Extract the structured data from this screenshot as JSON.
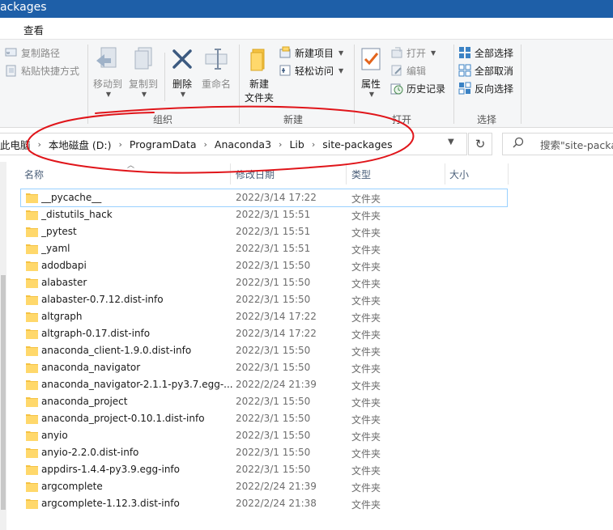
{
  "window": {
    "title": "ackages"
  },
  "ribbon_tab": "查看",
  "ribbon": {
    "clipboard_small": [
      {
        "label": "复制路径",
        "icon": "copy-path-icon"
      },
      {
        "label": "粘贴快捷方式",
        "icon": "paste-shortcut-icon"
      }
    ],
    "move_to": "移动到",
    "copy_to": "复制到",
    "delete": "删除",
    "rename": "重命名",
    "organize_label": "组织",
    "new_folder_line1": "新建",
    "new_folder_line2": "文件夹",
    "new_item": "新建项目",
    "easy_access": "轻松访问",
    "new_label": "新建",
    "properties": "属性",
    "open": "打开",
    "edit": "编辑",
    "history": "历史记录",
    "open_label": "打开",
    "select_all": "全部选择",
    "select_none": "全部取消",
    "invert_selection": "反向选择",
    "select_label": "选择"
  },
  "address": {
    "crumbs": [
      "此电脑",
      "本地磁盘 (D:)",
      "ProgramData",
      "Anaconda3",
      "Lib",
      "site-packages"
    ],
    "search_placeholder": "搜索\"site-packages\""
  },
  "columns": {
    "name": "名称",
    "date": "修改日期",
    "type": "类型",
    "size": "大小"
  },
  "files": [
    {
      "name": "__pycache__",
      "date": "2022/3/14 17:22",
      "type": "文件夹",
      "selected": true
    },
    {
      "name": "_distutils_hack",
      "date": "2022/3/1 15:51",
      "type": "文件夹"
    },
    {
      "name": "_pytest",
      "date": "2022/3/1 15:51",
      "type": "文件夹"
    },
    {
      "name": "_yaml",
      "date": "2022/3/1 15:51",
      "type": "文件夹"
    },
    {
      "name": "adodbapi",
      "date": "2022/3/1 15:50",
      "type": "文件夹"
    },
    {
      "name": "alabaster",
      "date": "2022/3/1 15:50",
      "type": "文件夹"
    },
    {
      "name": "alabaster-0.7.12.dist-info",
      "date": "2022/3/1 15:50",
      "type": "文件夹"
    },
    {
      "name": "altgraph",
      "date": "2022/3/14 17:22",
      "type": "文件夹"
    },
    {
      "name": "altgraph-0.17.dist-info",
      "date": "2022/3/14 17:22",
      "type": "文件夹"
    },
    {
      "name": "anaconda_client-1.9.0.dist-info",
      "date": "2022/3/1 15:50",
      "type": "文件夹"
    },
    {
      "name": "anaconda_navigator",
      "date": "2022/3/1 15:50",
      "type": "文件夹"
    },
    {
      "name": "anaconda_navigator-2.1.1-py3.7.egg-...",
      "date": "2022/2/24 21:39",
      "type": "文件夹"
    },
    {
      "name": "anaconda_project",
      "date": "2022/3/1 15:50",
      "type": "文件夹"
    },
    {
      "name": "anaconda_project-0.10.1.dist-info",
      "date": "2022/3/1 15:50",
      "type": "文件夹"
    },
    {
      "name": "anyio",
      "date": "2022/3/1 15:50",
      "type": "文件夹"
    },
    {
      "name": "anyio-2.2.0.dist-info",
      "date": "2022/3/1 15:50",
      "type": "文件夹"
    },
    {
      "name": "appdirs-1.4.4-py3.9.egg-info",
      "date": "2022/3/1 15:50",
      "type": "文件夹"
    },
    {
      "name": "argcomplete",
      "date": "2022/2/24 21:39",
      "type": "文件夹"
    },
    {
      "name": "argcomplete-1.12.3.dist-info",
      "date": "2022/2/24 21:38",
      "type": "文件夹"
    }
  ],
  "colors": {
    "titlebar": "#1e5fa8",
    "annotation": "#e0151a",
    "folder": "#f5c242",
    "selection_outline": "#99d1ff"
  }
}
